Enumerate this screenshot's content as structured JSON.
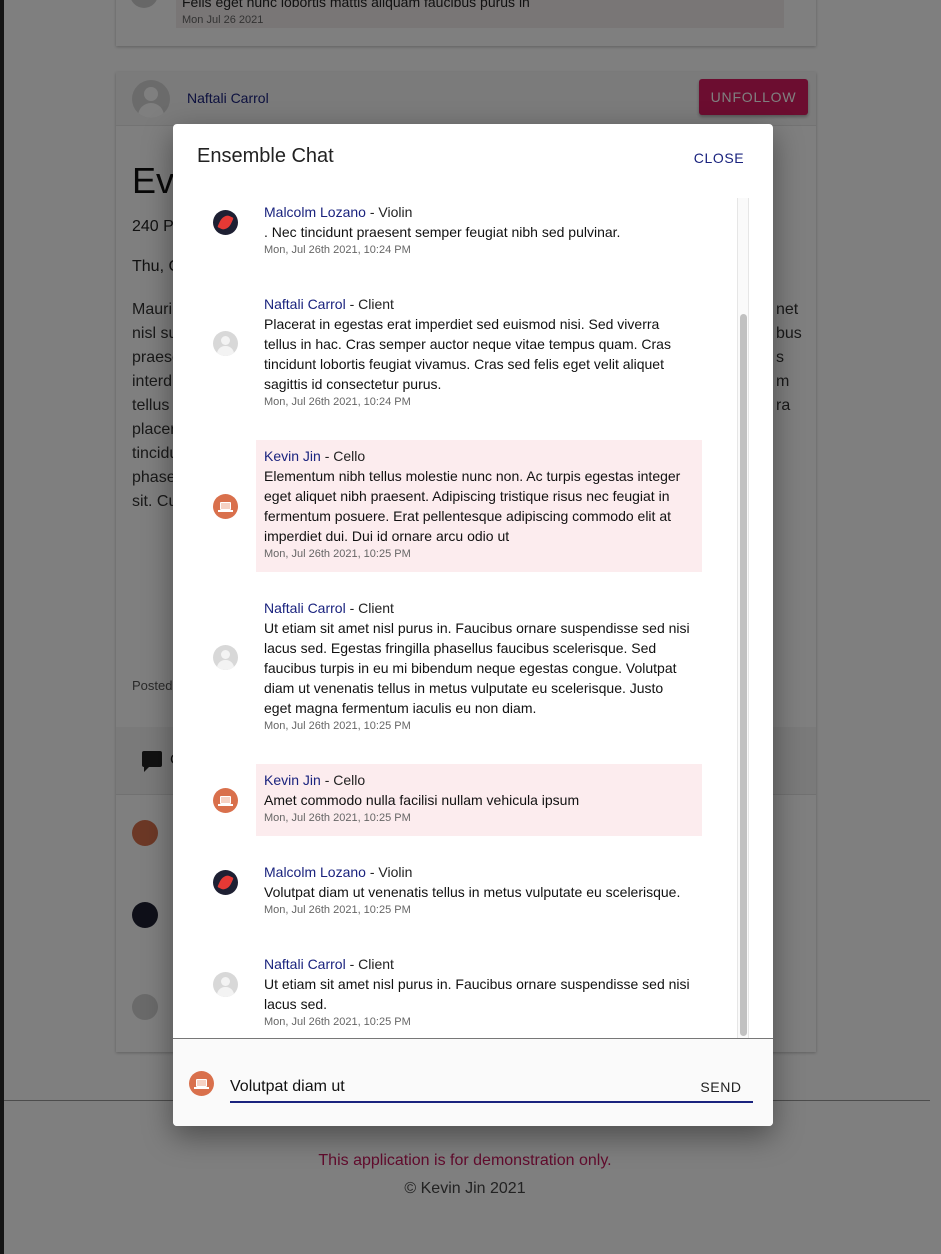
{
  "background": {
    "prev_comment": {
      "text": "Felis eget nunc lobortis mattis aliquam faucibus purus in",
      "date": "Mon Jul 26 2021"
    },
    "post_header": {
      "author": "Naftali Carrol",
      "unfollow_label": "UNFOLLOW"
    },
    "post_title_fragment": "Eve",
    "post_line1_fragment": "240 P",
    "post_line2_fragment": "Thu, C",
    "post_para_left": [
      "Mauri",
      "nisl su",
      "praese",
      "interd",
      "tellus",
      "placer",
      "tincidu",
      "phase",
      "sit. Cu"
    ],
    "post_para_right": [
      "net",
      "",
      "bus",
      "s",
      "",
      "",
      "m",
      "ra",
      ""
    ],
    "posted_fragment": "Posted",
    "comments_label_fragment": "C",
    "footer_note": "This application is for demonstration only.",
    "footer_copy": "© Kevin Jin 2021"
  },
  "dialog": {
    "title": "Ensemble Chat",
    "close_label": "CLOSE",
    "messages": [
      {
        "name": "Malcolm Lozano",
        "role": " - Violin",
        "text": ". Nec tincidunt praesent semper feugiat nibh sed pulvinar.",
        "time": "Mon, Jul 26th 2021, 10:24 PM",
        "avatar": "violin-flame-avatar",
        "self": false
      },
      {
        "name": "Naftali Carrol",
        "role": " - Client",
        "text": "Placerat in egestas erat imperdiet sed euismod nisi. Sed viverra tellus in hac. Cras semper auctor neque vitae tempus quam. Cras tincidunt lobortis feugiat vivamus. Cras sed felis eget velit aliquet sagittis id consectetur purus.",
        "time": "Mon, Jul 26th 2021, 10:24 PM",
        "avatar": "default-user-avatar",
        "self": false
      },
      {
        "name": "Kevin Jin",
        "role": " - Cello",
        "text": "Elementum nibh tellus molestie nunc non. Ac turpis egestas integer eget aliquet nibh praesent. Adipiscing tristique risus nec feugiat in fermentum posuere. Erat pellentesque adipiscing commodo elit at imperdiet dui. Dui id ornare arcu odio ut",
        "time": "Mon, Jul 26th 2021, 10:25 PM",
        "avatar": "laptop-avatar",
        "self": true
      },
      {
        "name": "Naftali Carrol",
        "role": " - Client",
        "text": "Ut etiam sit amet nisl purus in. Faucibus ornare suspendisse sed nisi lacus sed. Egestas fringilla phasellus faucibus scelerisque. Sed faucibus turpis in eu mi bibendum neque egestas congue. Volutpat diam ut venenatis tellus in metus vulputate eu scelerisque. Justo eget magna fermentum iaculis eu non diam.",
        "time": "Mon, Jul 26th 2021, 10:25 PM",
        "avatar": "default-user-avatar",
        "self": false
      },
      {
        "name": "Kevin Jin",
        "role": " - Cello",
        "text": "Amet commodo nulla facilisi nullam vehicula ipsum",
        "time": "Mon, Jul 26th 2021, 10:25 PM",
        "avatar": "laptop-avatar",
        "self": true
      },
      {
        "name": "Malcolm Lozano",
        "role": " - Violin",
        "text": "Volutpat diam ut venenatis tellus in metus vulputate eu scelerisque.",
        "time": "Mon, Jul 26th 2021, 10:25 PM",
        "avatar": "violin-flame-avatar",
        "self": false
      },
      {
        "name": "Naftali Carrol",
        "role": " - Client",
        "text": "Ut etiam sit amet nisl purus in. Faucibus ornare suspendisse sed nisi lacus sed.",
        "time": "Mon, Jul 26th 2021, 10:25 PM",
        "avatar": "default-user-avatar",
        "self": false
      }
    ],
    "compose": {
      "value": "Volutpat diam ut",
      "send_label": "SEND",
      "avatar": "laptop-avatar"
    }
  },
  "colors": {
    "accent": "#1a237e",
    "unfollow": "#d81b60",
    "self_bubble": "#fcecee",
    "footer_note": "#c2185b"
  }
}
